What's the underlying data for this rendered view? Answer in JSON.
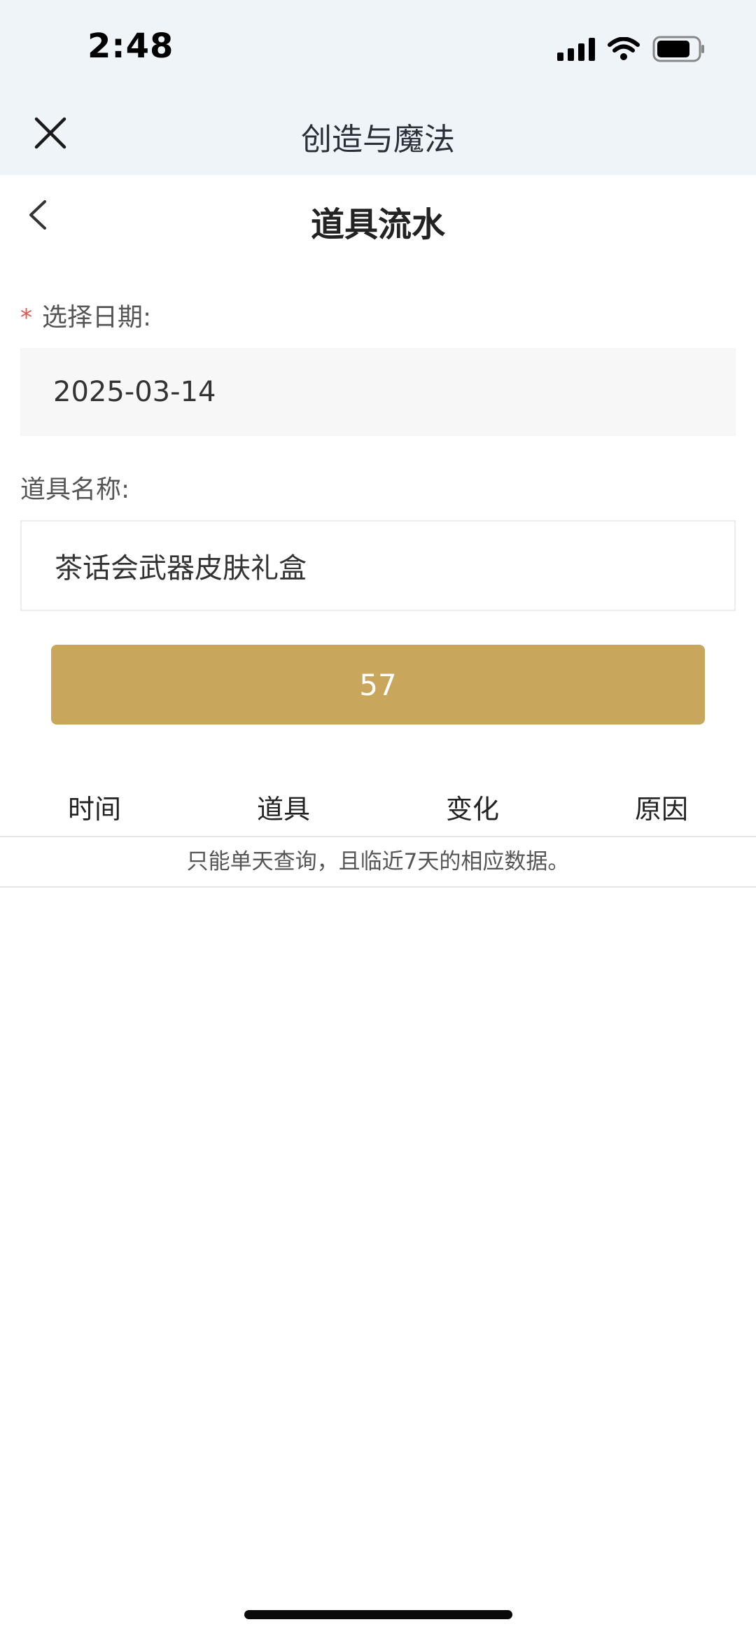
{
  "status_bar": {
    "time": "2:48",
    "icons": [
      "cellular-signal-icon",
      "wifi-icon",
      "battery-icon"
    ]
  },
  "mini_program": {
    "title": "创造与魔法",
    "close_icon": "close-icon"
  },
  "page": {
    "title": "道具流水",
    "back_icon": "chevron-left-icon"
  },
  "form": {
    "date_required_mark": "*",
    "date_label": "选择日期:",
    "date_value": "2025-03-14",
    "item_name_label": "道具名称:",
    "item_name_value": "茶话会武器皮肤礼盒",
    "query_button_label": "57"
  },
  "table": {
    "columns": [
      "时间",
      "道具",
      "变化",
      "原因"
    ],
    "rows": [],
    "empty_notice": "只能单天查询，且临近7天的相应数据。"
  },
  "colors": {
    "header_background": "#eef4f7",
    "button_gold": "#c8a65c",
    "required_star": "#e0584e"
  }
}
